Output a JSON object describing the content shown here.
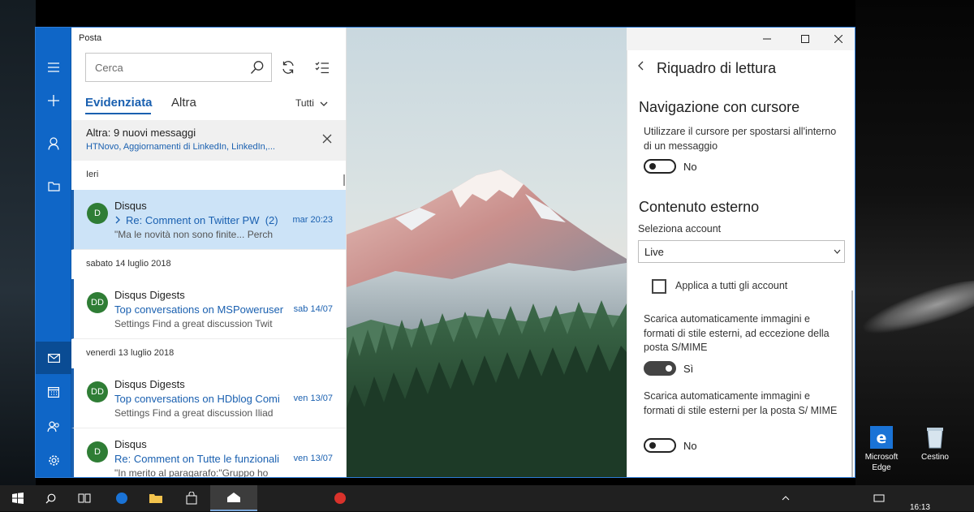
{
  "desktop": {
    "icons": [
      {
        "name": "edge",
        "label_line1": "Microsoft",
        "label_line2": "Edge"
      },
      {
        "name": "recycle-bin",
        "label": "Cestino"
      }
    ],
    "clock": "16:13"
  },
  "mail": {
    "app_title": "Posta",
    "search": {
      "placeholder": "Cerca"
    },
    "tabs": {
      "focused": "Evidenziata",
      "other": "Altra"
    },
    "filter": "Tutti",
    "other_banner": {
      "title": "Altra: 9 nuovi messaggi",
      "senders": "HTNovo, Aggiornamenti di LinkedIn, LinkedIn,..."
    },
    "groups": [
      {
        "header": "Ieri",
        "messages": [
          {
            "initials": "D",
            "sender": "Disqus",
            "subject": "Re: Comment on Twitter PW",
            "count": "(2)",
            "date": "mar 20:23",
            "preview": "\"Ma le novità non sono finite... Perch",
            "selected": true
          }
        ]
      },
      {
        "header": "sabato 14 luglio 2018",
        "messages": [
          {
            "initials": "DD",
            "sender": "Disqus Digests",
            "subject": "Top conversations on MSPoweruser",
            "date": "sab 14/07",
            "preview": "Settings Find a great discussion Twit"
          }
        ]
      },
      {
        "header": "venerdì 13 luglio 2018",
        "messages": [
          {
            "initials": "DD",
            "sender": "Disqus Digests",
            "subject": "Top conversations on HDblog Comi",
            "date": "ven 13/07",
            "preview": "Settings Find a great discussion Iliad"
          },
          {
            "initials": "D",
            "sender": "Disqus",
            "subject": "Re: Comment on Tutte le funzionali",
            "date": "ven 13/07",
            "preview": "\"In merito al paragarafo:\"Gruppo ho"
          }
        ]
      }
    ]
  },
  "settings": {
    "title": "Riquadro di lettura",
    "cursor_nav": {
      "heading": "Navigazione con cursore",
      "desc": "Utilizzare il cursore per spostarsi all'interno di un messaggio",
      "toggle_label": "No",
      "toggle_on": false
    },
    "external": {
      "heading": "Contenuto esterno",
      "account_label": "Seleziona account",
      "account_value": "Live",
      "apply_all": "Applica a tutti gli account",
      "download_desc": "Scarica automaticamente immagini e formati di stile esterni, ad eccezione della posta S/MIME",
      "download_toggle_label": "Sì",
      "download_toggle_on": true,
      "smime_desc": "Scarica automaticamente immagini e formati di stile esterni per la posta S/ MIME",
      "smime_toggle_label": "No",
      "smime_toggle_on": false
    }
  },
  "colors": {
    "accent": "#0f66c7",
    "avatar": "#2f7d35",
    "selected_row": "#cce3f7"
  }
}
